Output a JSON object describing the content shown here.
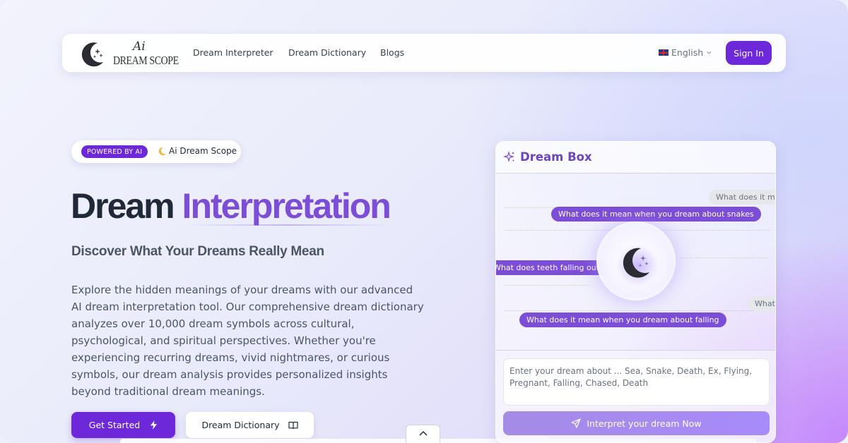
{
  "nav": {
    "logo": {
      "ai": "Ai",
      "text": "DREAM SCOPE"
    },
    "links": [
      "Dream Interpreter",
      "Dream Dictionary",
      "Blogs"
    ],
    "language": "English",
    "sign_in": "Sign In"
  },
  "hero": {
    "badge_pill": "POWERED BY AI",
    "badge_text": "Ai Dream Scope",
    "title_part1": "Dream",
    "title_part2": "Interpretation",
    "subtitle": "Discover What Your Dreams Really Mean",
    "description": "Explore the hidden meanings of your dreams with our advanced AI dream interpretation tool. Our comprehensive dream dictionary analyzes over 10,000 dream symbols across cultural, psychological, and spiritual perspectives. Whether you're experiencing recurring dreams, vivid nightmares, or curious symbols, our dream analysis provides personalized insights beyond traditional dream meanings.",
    "get_started": "Get Started",
    "dream_dictionary": "Dream Dictionary"
  },
  "dream_box": {
    "title": "Dream Box",
    "chips": [
      {
        "text": "What does it mea",
        "style": "grey"
      },
      {
        "text": "What does it mean when you dream about snakes",
        "style": "purple"
      },
      {
        "text": "What does teeth falling out in a dream mean",
        "style": "purple"
      },
      {
        "text": "What d",
        "style": "grey"
      },
      {
        "text": "What does it mean when you dream about falling",
        "style": "purple"
      }
    ],
    "input_placeholder": "Enter your dream about ... Sea, Snake, Death, Ex, Flying, Pregnant, Falling, Chased, Death",
    "submit": "Interpret your dream Now"
  },
  "colors": {
    "primary": "#6d28d9",
    "accent_text": "#7c4dd6",
    "chip_purple": "#7c4dd6",
    "chip_grey": "#e5e7eb"
  },
  "icons": {
    "logo": "crescent-moon-icon",
    "language": "uk-flag-icon",
    "language_caret": "chevron-down-icon",
    "badge": "crescent-moon-icon",
    "get_started": "lightning-icon",
    "dream_dictionary": "book-open-icon",
    "dream_box": "sparkles-icon",
    "submit": "send-icon",
    "scroll": "chevron-up-icon"
  }
}
